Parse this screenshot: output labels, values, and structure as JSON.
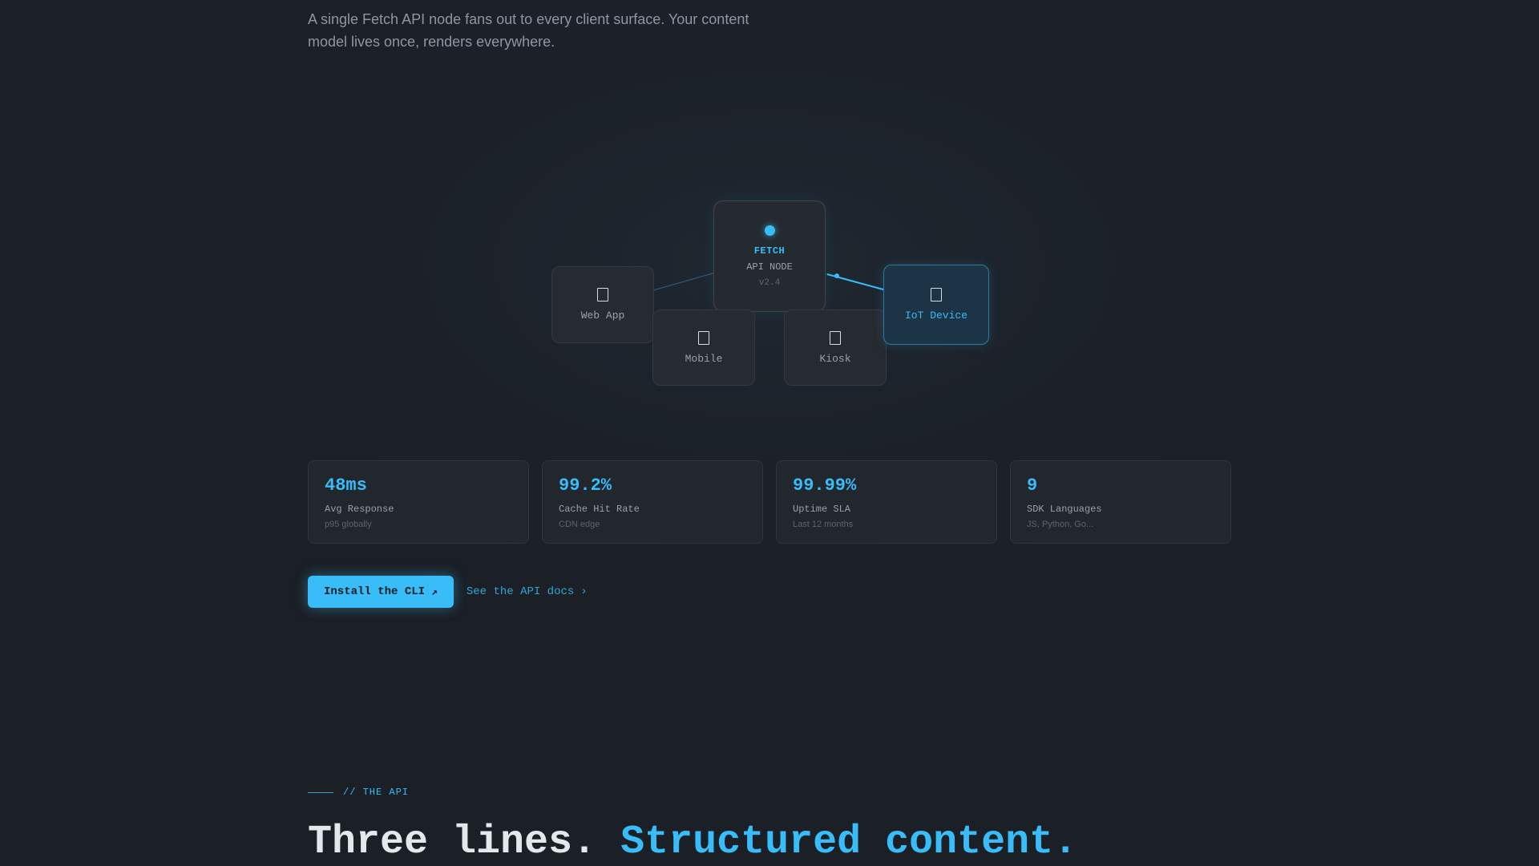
{
  "intro": {
    "text": "A single Fetch API node fans out to every client surface. Your content model lives once, renders everywhere."
  },
  "diagram": {
    "hub": {
      "name": "FETCH",
      "sub": "API NODE",
      "version": "v2.4"
    },
    "clients": [
      {
        "label": "Web App",
        "icon": "browser-icon",
        "active": false
      },
      {
        "label": "Mobile",
        "icon": "phone-icon",
        "active": false
      },
      {
        "label": "Kiosk",
        "icon": "kiosk-icon",
        "active": false
      },
      {
        "label": "IoT Device",
        "icon": "iot-icon",
        "active": true
      }
    ]
  },
  "stats": [
    {
      "value": "48ms",
      "label": "Avg Response",
      "note": "p95 globally"
    },
    {
      "value": "99.2%",
      "label": "Cache Hit Rate",
      "note": "CDN edge"
    },
    {
      "value": "99.99%",
      "label": "Uptime SLA",
      "note": "Last 12 months"
    },
    {
      "value": "9",
      "label": "SDK Languages",
      "note": "JS, Python, Go..."
    }
  ],
  "actions": {
    "primary_label": "Install the CLI",
    "primary_icon": "arrow-up-right-icon",
    "secondary_label": "See the API docs",
    "secondary_icon": "chevron-right-icon"
  },
  "api_section": {
    "eyebrow": "// THE API",
    "headline_main": "Three lines.",
    "headline_accent": "Structured content."
  },
  "colors": {
    "accent": "#38bdf8",
    "background": "#1b1f26",
    "card": "#22262d"
  }
}
